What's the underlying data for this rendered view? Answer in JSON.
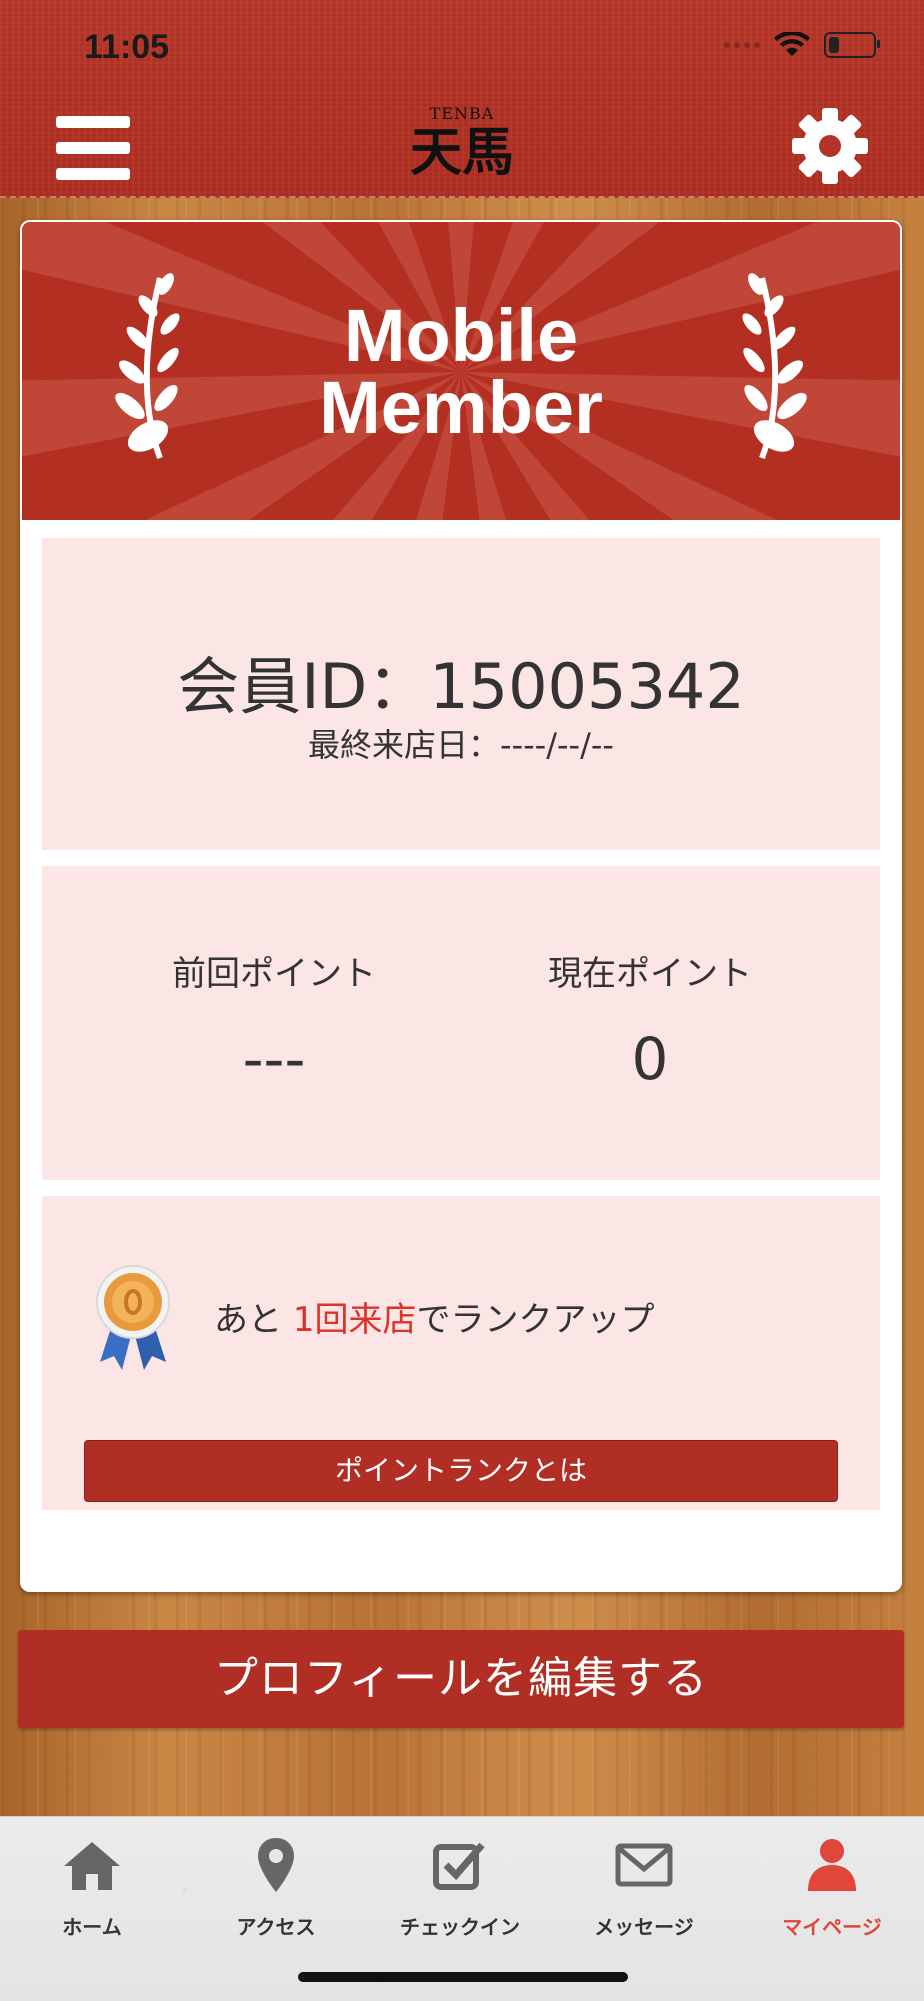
{
  "status_bar": {
    "time": "11:05"
  },
  "header": {
    "logo_en": "TENBA",
    "logo_jp": "天馬"
  },
  "banner": {
    "title_line1": "Mobile",
    "title_line2": "Member"
  },
  "member": {
    "id_text": "会員ID：15005342",
    "last_visit_text": "最終来店日：----/--/--"
  },
  "points": {
    "previous_label": "前回ポイント",
    "previous_value": "---",
    "current_label": "現在ポイント",
    "current_value": "0"
  },
  "rank": {
    "text_before": "あと ",
    "highlight": "1回来店",
    "text_after": "でランクアップ",
    "button_label": "ポイントランクとは"
  },
  "edit_profile_label": "プロフィールを編集する",
  "tabs": [
    {
      "label": "ホーム",
      "icon": "home-icon"
    },
    {
      "label": "アクセス",
      "icon": "map-pin-icon"
    },
    {
      "label": "チェックイン",
      "icon": "checkbox-icon"
    },
    {
      "label": "メッセージ",
      "icon": "envelope-icon"
    },
    {
      "label": "マイページ",
      "icon": "person-icon",
      "active": true
    }
  ],
  "colors": {
    "brand_red": "#b02e23",
    "highlight_red": "#d9342b",
    "panel_pink": "#fbe5e5",
    "active_tab": "#e0463a"
  }
}
